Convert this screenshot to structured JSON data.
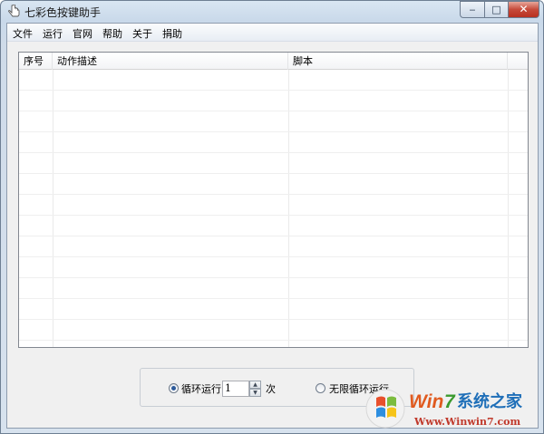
{
  "window": {
    "title": "七彩色按键助手",
    "minimize_glyph": "‒",
    "maximize_glyph": "□",
    "close_glyph": "✕"
  },
  "menu": {
    "items": [
      "文件",
      "运行",
      "官网",
      "帮助",
      "关于",
      "捐助"
    ]
  },
  "list": {
    "columns": [
      "序号",
      "动作描述",
      "脚本"
    ],
    "rows": []
  },
  "loop": {
    "loop_label": "循环运行",
    "count_value": "1",
    "count_unit": "次",
    "infinite_label": "无限循环运行",
    "selected": "loop"
  },
  "watermark": {
    "brand": "Win7系统之家",
    "url": "Www.Winwin7.com"
  },
  "colors": {
    "accent": "#2d5a9a",
    "close_button": "#c64a3a",
    "window_frame": "#c9d9ea"
  }
}
